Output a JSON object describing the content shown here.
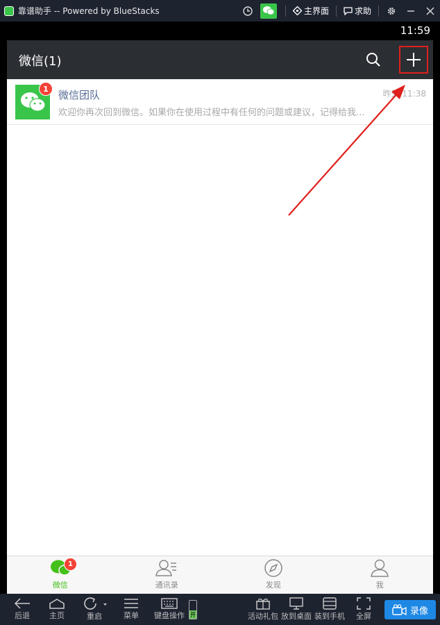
{
  "window": {
    "title": "靠谱助手 -- Powered by BlueStacks",
    "home_label": "主界面",
    "help_label": "求助"
  },
  "statusbar": {
    "time": "11:59"
  },
  "wechat": {
    "header_title": "微信(1)",
    "chats": [
      {
        "name": "微信团队",
        "time": "昨天 11:38",
        "preview": "欢迎你再次回到微信。如果你在使用过程中有任何的问题或建议，记得给我...",
        "unread": "1"
      }
    ],
    "tabs": [
      {
        "label": "微信",
        "badge": "1"
      },
      {
        "label": "通讯录"
      },
      {
        "label": "发现"
      },
      {
        "label": "我"
      }
    ],
    "colors": {
      "header": "#2b2e33",
      "accent": "#45c01a",
      "badge": "#f44336",
      "annotation": "#e0201c"
    }
  },
  "emulator_bar": {
    "back": "后退",
    "home": "主页",
    "restart": "重启",
    "menu": "菜单",
    "keyboard": "键盘操作",
    "keyboard_toggle": "开",
    "gift": "活动礼包",
    "desktop": "放到桌面",
    "phone": "装到手机",
    "fullscreen": "全屏",
    "record": "录像"
  }
}
